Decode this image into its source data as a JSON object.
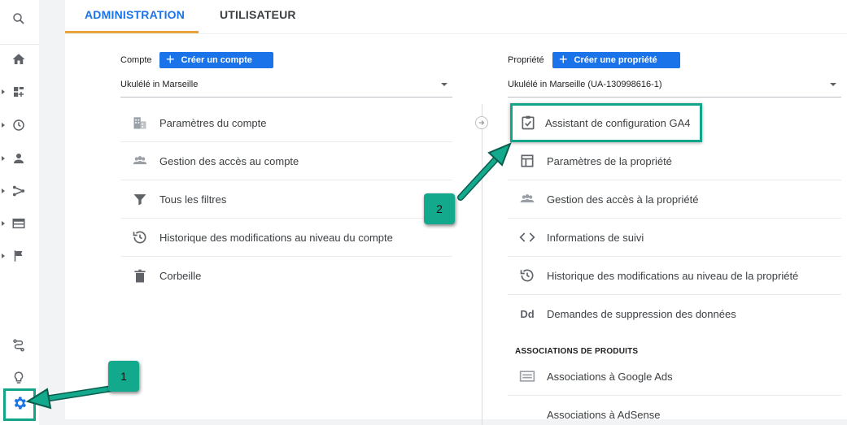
{
  "tabs": {
    "admin": "ADMINISTRATION",
    "user": "UTILISATEUR"
  },
  "account": {
    "label": "Compte",
    "create_button": "Créer un compte",
    "selected": "Ukulélé in Marseille",
    "items": [
      {
        "label": "Paramètres du compte",
        "icon": "building-icon"
      },
      {
        "label": "Gestion des accès au compte",
        "icon": "people-icon"
      },
      {
        "label": "Tous les filtres",
        "icon": "filter-icon"
      },
      {
        "label": "Historique des modifications au niveau du compte",
        "icon": "history-icon"
      },
      {
        "label": "Corbeille",
        "icon": "trash-icon"
      }
    ]
  },
  "property": {
    "label": "Propriété",
    "create_button": "Créer une propriété",
    "selected": "Ukulélé in Marseille (UA-130998616-1)",
    "items": [
      {
        "label": "Assistant de configuration GA4",
        "icon": "checklist-icon"
      },
      {
        "label": "Paramètres de la propriété",
        "icon": "layout-icon"
      },
      {
        "label": "Gestion des accès à la propriété",
        "icon": "people-icon"
      },
      {
        "label": "Informations de suivi",
        "icon": "code-icon"
      },
      {
        "label": "Historique des modifications au niveau de la propriété",
        "icon": "history-icon"
      },
      {
        "label": "Demandes de suppression des données",
        "icon": "dd-icon"
      }
    ],
    "section_heading": "ASSOCIATIONS DE PRODUITS",
    "dd_glyph": "Dd",
    "product_links": [
      {
        "label": "Associations à Google Ads",
        "icon": "ads-icon"
      },
      {
        "label": "Associations à AdSense",
        "icon": ""
      }
    ]
  },
  "callouts": {
    "one": "1",
    "two": "2"
  },
  "colors": {
    "accent": "#1a73e8",
    "highlight": "#12a58a",
    "tab_underline": "#e8a33d"
  }
}
